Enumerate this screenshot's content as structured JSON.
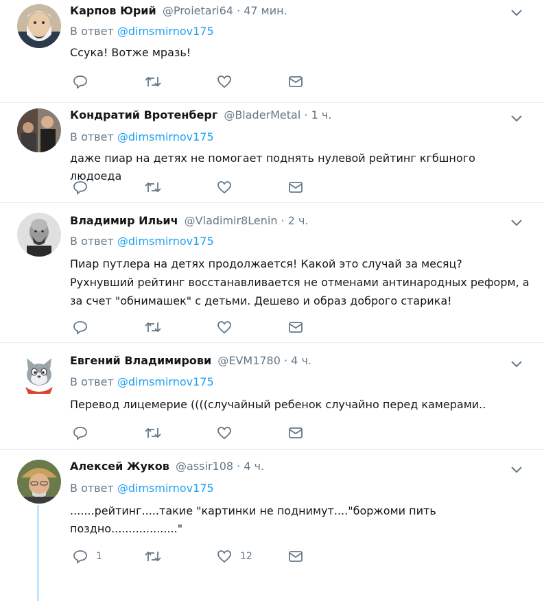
{
  "reply_prefix": "В ответ",
  "tweets": [
    {
      "name": "Карпов Юрий",
      "handle": "@Proietari64",
      "time": "47 мин.",
      "mention": "@dimsmirnov175",
      "text": "Ссука! Вотже мразь!",
      "reply_count": "",
      "like_count": "",
      "avatar": "avatar-bearded-old-man"
    },
    {
      "name": "Кондратий Вротенберг",
      "handle": "@BladerMetal",
      "time": "1 ч.",
      "mention": "@dimsmirnov175",
      "text": "даже пиар на детях не помогает поднять нулевой рейтинг кгбшного людоеда",
      "reply_count": "",
      "like_count": "",
      "avatar": "avatar-photo-group"
    },
    {
      "name": "Владимир Ильич",
      "handle": "@Vladimir8Lenin",
      "time": "2 ч.",
      "mention": "@dimsmirnov175",
      "text": "Пиар путлера на детях продолжается! Какой это случай за месяц? Рухнувший рейтинг восстанавливается не отменами антинародных реформ, а за счет \"обнимашек\" с детьми. Дешево и образ доброго старика!",
      "reply_count": "",
      "like_count": "",
      "avatar": "avatar-lenin"
    },
    {
      "name": "Евгений Владимирови",
      "handle": "@EVM1780",
      "time": "4 ч.",
      "mention": "@dimsmirnov175",
      "text": "Перевод лицемерие ((((случайный ребенок случайно перед камерами..",
      "reply_count": "",
      "like_count": "",
      "avatar": "avatar-cartoon-cat"
    },
    {
      "name": "Алексей Жуков",
      "handle": "@assir108",
      "time": "4 ч.",
      "mention": "@dimsmirnov175",
      "text": ".......рейтинг.....такие \"картинки  не поднимут....\"боржоми пить поздно...................\"",
      "reply_count": "1",
      "like_count": "12",
      "avatar": "avatar-man-cap"
    }
  ],
  "colors": {
    "link": "#1da1f2",
    "secondary": "#657786",
    "divider": "#e6ecf0",
    "thread_line": "#c4e4fb"
  },
  "icons": [
    "reply-icon",
    "retweet-icon",
    "like-icon",
    "message-icon",
    "chevron-down-icon"
  ]
}
